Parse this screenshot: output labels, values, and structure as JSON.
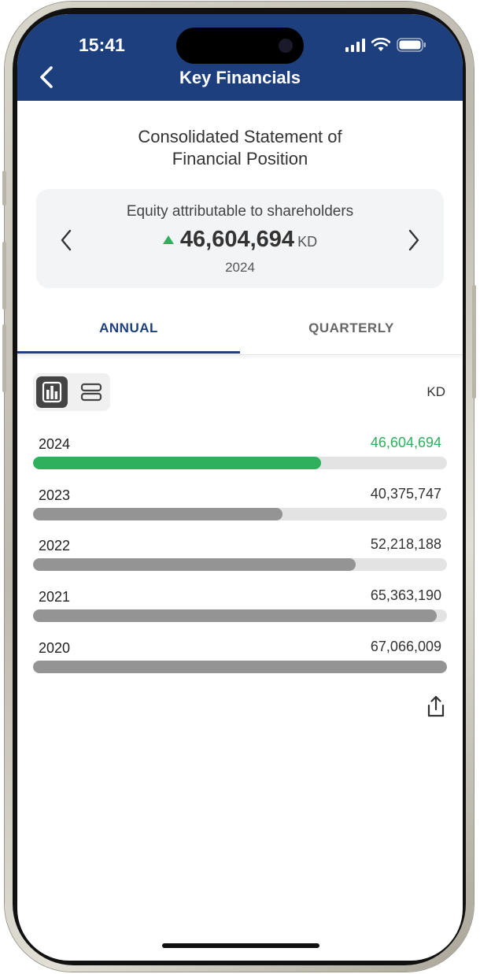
{
  "status_bar": {
    "time": "15:41"
  },
  "header": {
    "title": "Key Financials"
  },
  "statement_title_line1": "Consolidated Statement of",
  "statement_title_line2": "Financial Position",
  "summary_card": {
    "label": "Equity attributable to shareholders",
    "value": "46,604,694",
    "unit": "KD",
    "year": "2024",
    "trend": "up"
  },
  "tabs": [
    {
      "label": "ANNUAL",
      "active": true
    },
    {
      "label": "QUARTERLY",
      "active": false
    }
  ],
  "view_toggle": {
    "selected": "bar-chart-icon",
    "other": "list-view-icon"
  },
  "unit_label": "KD",
  "colors": {
    "brand": "#1e3f7e",
    "positive": "#2eb05d",
    "bar_default": "#949494",
    "track": "#e3e3e3"
  },
  "chart_data": {
    "type": "bar",
    "orientation": "horizontal",
    "categories": [
      "2024",
      "2023",
      "2022",
      "2021",
      "2020"
    ],
    "values": [
      46604694,
      40375747,
      52218188,
      65363190,
      67066009
    ],
    "value_labels": [
      "46,604,694",
      "40,375,747",
      "52,218,188",
      "65,363,190",
      "67,066,009"
    ],
    "highlighted": "2024",
    "xlim": [
      0,
      67066009
    ]
  }
}
